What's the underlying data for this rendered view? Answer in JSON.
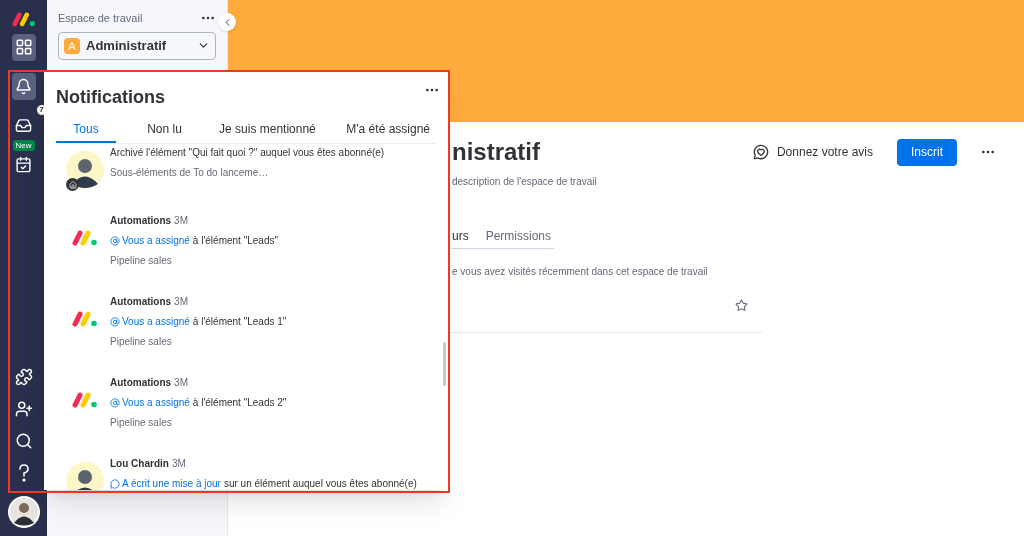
{
  "rail": {
    "items": [
      {
        "kind": "workspaces",
        "selected": true
      },
      {
        "kind": "notifications",
        "selected": true
      },
      {
        "kind": "inbox",
        "selected": false,
        "badge": "7"
      },
      {
        "kind": "my-work",
        "selected": false,
        "badge": "New"
      }
    ]
  },
  "workspace_panel": {
    "label": "Espace de travail",
    "workspace": {
      "letter": "A",
      "name": "Administratif"
    }
  },
  "notifications": {
    "title": "Notifications",
    "tabs": [
      {
        "label": "Tous",
        "selected": true
      },
      {
        "label": "Non lu",
        "selected": false
      },
      {
        "label": "Je suis mentionné",
        "selected": false
      },
      {
        "label": "M'a été assigné",
        "selected": false
      }
    ],
    "items": [
      {
        "kind": "photo",
        "home_badge": true,
        "text": "Archivé l'élément \"Qui fait quoi ?\" auquel vous êtes abonné(e)",
        "board": "Sous-éléments de To do lanceme…"
      },
      {
        "kind": "logo",
        "author": "Automations",
        "time": "3M",
        "action": {
          "kind": "assign",
          "link": "Vous a assigné",
          "rest": "à l'élément \"Leads\""
        },
        "board": "Pipeline sales"
      },
      {
        "kind": "logo",
        "author": "Automations",
        "time": "3M",
        "action": {
          "kind": "assign",
          "link": "Vous a assigné",
          "rest": "à l'élément \"Leads 1\""
        },
        "board": "Pipeline sales"
      },
      {
        "kind": "logo",
        "author": "Automations",
        "time": "3M",
        "action": {
          "kind": "assign",
          "link": "Vous a assigné",
          "rest": "à l'élément \"Leads 2\""
        },
        "board": "Pipeline sales"
      },
      {
        "kind": "photo",
        "home_badge": false,
        "author": "Lou Chardin",
        "time": "3M",
        "action": {
          "kind": "comment",
          "link": "A écrit une mise à jour",
          "rest": "sur un élément auquel vous êtes abonné(e)"
        }
      }
    ]
  },
  "main": {
    "title": "nistratif",
    "description": "description de l'espace de travail",
    "feedback": "Donnez votre avis",
    "subscribe_button": "Inscrit",
    "tabs": [
      {
        "label": "urs",
        "selected": true
      },
      {
        "label": "Permissions",
        "selected": false
      }
    ],
    "recent_text": "e vous avez visités récemment dans cet espace de travail"
  }
}
